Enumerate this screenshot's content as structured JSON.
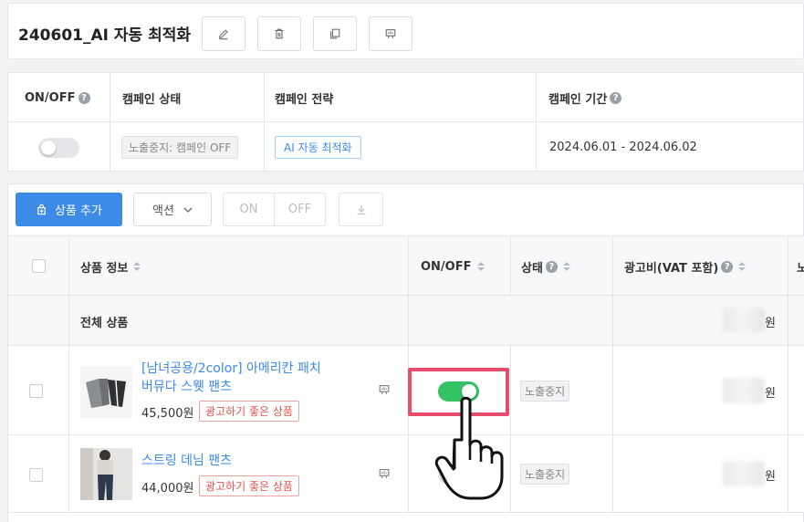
{
  "campaign": {
    "title": "240601_AI 자동 최적화",
    "toolbar": {
      "edit_icon": "pencil-icon",
      "delete_icon": "trash-icon",
      "copy_icon": "copy-icon",
      "report_icon": "presentation-icon"
    }
  },
  "campaign_table": {
    "headers": {
      "onoff": "ON/OFF",
      "status": "캠페인 상태",
      "strategy": "캠페인 전략",
      "period": "캠페인 기간"
    },
    "help_glyph": "?",
    "row": {
      "status": "노출중지: 캠페인 OFF",
      "strategy": "AI 자동 최적화",
      "period": "2024.06.01 - 2024.06.02",
      "toggle_on": false
    }
  },
  "product_toolbar": {
    "add_product": "상품 추가",
    "action": "액션",
    "on": "ON",
    "off": "OFF",
    "download_icon": "download-icon"
  },
  "product_table": {
    "headers": {
      "info": "상품 정보",
      "onoff": "ON/OFF",
      "status": "상태",
      "adcost": "광고비(VAT 포함)",
      "next_partial": "노"
    },
    "total_label": "전체 상품",
    "currency": "원",
    "rows": [
      {
        "name": "[남녀공용/2color] 아메리칸 패치 버뮤다 스웻 팬츠",
        "price": "45,500원",
        "tag": "광고하기 좋은 상품",
        "toggle_on": true,
        "status": "노출중지"
      },
      {
        "name": "스트링 데님 팬츠",
        "price": "44,000원",
        "tag": "광고하기 좋은 상품",
        "toggle_on": false,
        "status": "노출중지"
      }
    ]
  },
  "colors": {
    "primary": "#3c8be6",
    "toggle_on": "#34c265",
    "highlight": "#e84d6b",
    "tag_red": "#e2534b"
  }
}
